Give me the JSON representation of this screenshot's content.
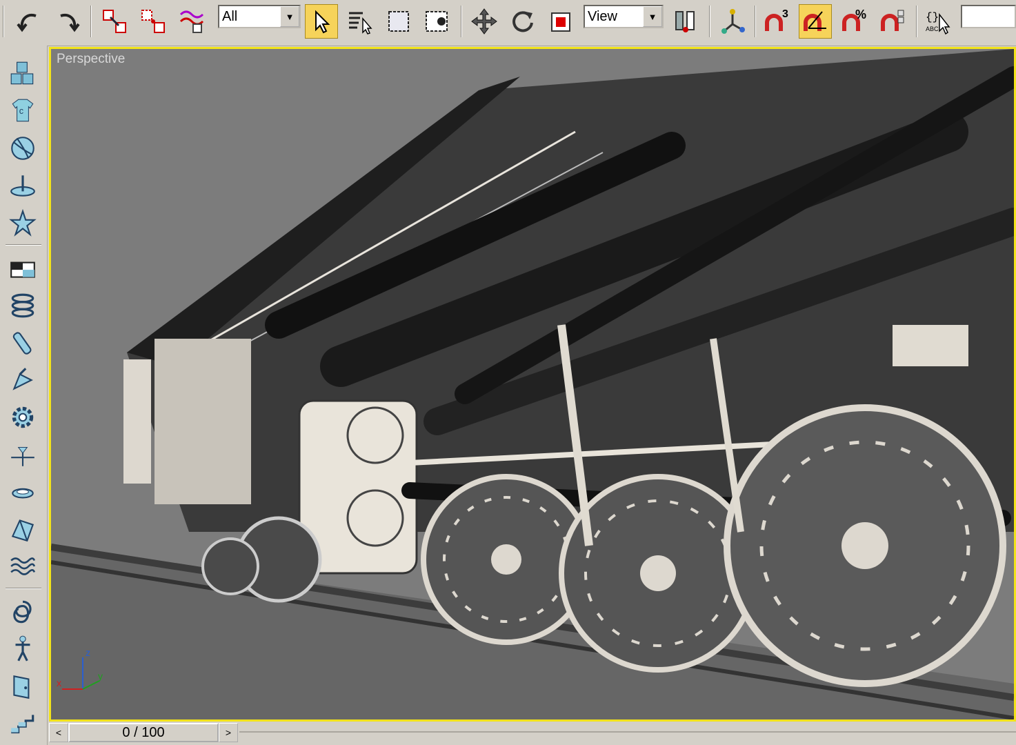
{
  "toolbar": {
    "selection_filter": "All",
    "reference_coord": "View",
    "snap_label": "3",
    "percent_snap_label": "%",
    "edit_named_label": "ABC",
    "active_accent": "#f6d35a"
  },
  "viewport": {
    "label": "Perspective",
    "border_color": "#f2e31a",
    "axis": {
      "x": "x",
      "y": "y",
      "z": "z"
    }
  },
  "timeslider": {
    "frame_label": "0 / 100",
    "prev_glyph": "<",
    "next_glyph": ">"
  },
  "icons": {
    "toolbar": [
      "undo-icon",
      "redo-icon",
      "select-and-link-icon",
      "unlink-selection-icon",
      "bind-to-space-warp-icon",
      "select-object-icon",
      "select-by-name-icon",
      "rectangular-selection-icon",
      "window-crossing-icon",
      "select-and-move-icon",
      "select-and-rotate-icon",
      "select-and-scale-icon",
      "use-pivot-center-icon",
      "select-and-manipulate-icon",
      "snap-toggle-icon",
      "angle-snap-icon",
      "percent-snap-icon",
      "spinner-snap-icon",
      "edit-named-selection-icon"
    ],
    "left_tabs": [
      "create-geometry-icon",
      "create-compound-icon",
      "create-particles-icon",
      "create-patch-grids-icon",
      "create-nurbs-icon",
      "create-box-icon",
      "create-helix-icon",
      "create-cylinder-icon",
      "create-light-icon",
      "create-helper-icon",
      "create-space-warp-icon",
      "create-system-icon",
      "create-fish-icon",
      "create-dynamics-icon",
      "create-wave-icon",
      "create-knot-icon",
      "create-biped-icon",
      "create-door-icon",
      "create-stairs-icon"
    ]
  }
}
